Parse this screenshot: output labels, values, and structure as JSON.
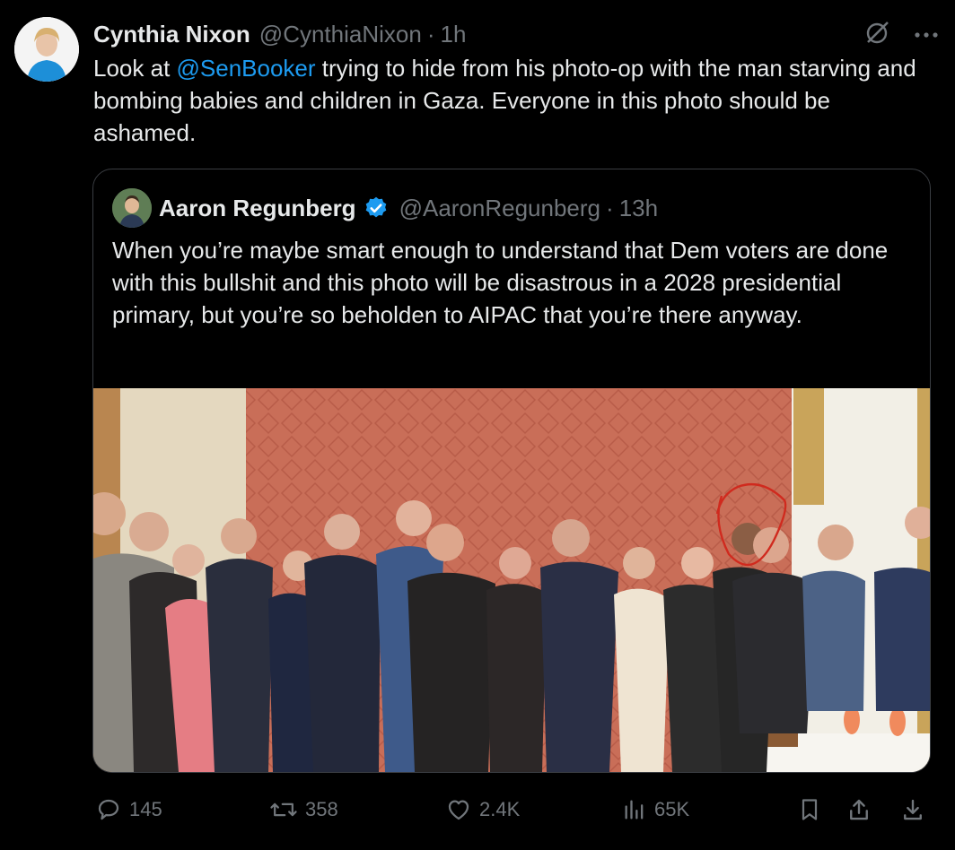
{
  "tweet": {
    "author_name": "Cynthia Nixon",
    "author_handle": "@CynthiaNixon",
    "separator": "·",
    "time": "1h",
    "text_before": "Look at ",
    "mention": "@SenBooker",
    "text_after": " trying to hide from his photo-op with the man starving and bombing babies and children in Gaza.  Everyone in this photo should be ashamed."
  },
  "quote": {
    "author_name": "Aaron Regunberg",
    "author_handle": "@AaronRegunberg",
    "separator": "·",
    "time": "13h",
    "verified": true,
    "text": "When you’re maybe smart enough to understand that Dem voters are done with this bullshit and this photo will be disastrous in a 2028 presidential primary, but you’re so beholden to AIPAC that you’re there anyway."
  },
  "actions": {
    "replies": "145",
    "reposts": "358",
    "likes": "2.4K",
    "views": "65K"
  },
  "colors": {
    "background": "#000000",
    "text": "#e7e9ea",
    "secondary": "#71767b",
    "accent": "#1d9bf0",
    "border": "#3a3d42"
  },
  "icons": [
    "grok-icon",
    "more-icon",
    "verified-icon",
    "reply-icon",
    "repost-icon",
    "like-icon",
    "views-icon",
    "bookmark-icon",
    "share-icon",
    "download-icon"
  ]
}
